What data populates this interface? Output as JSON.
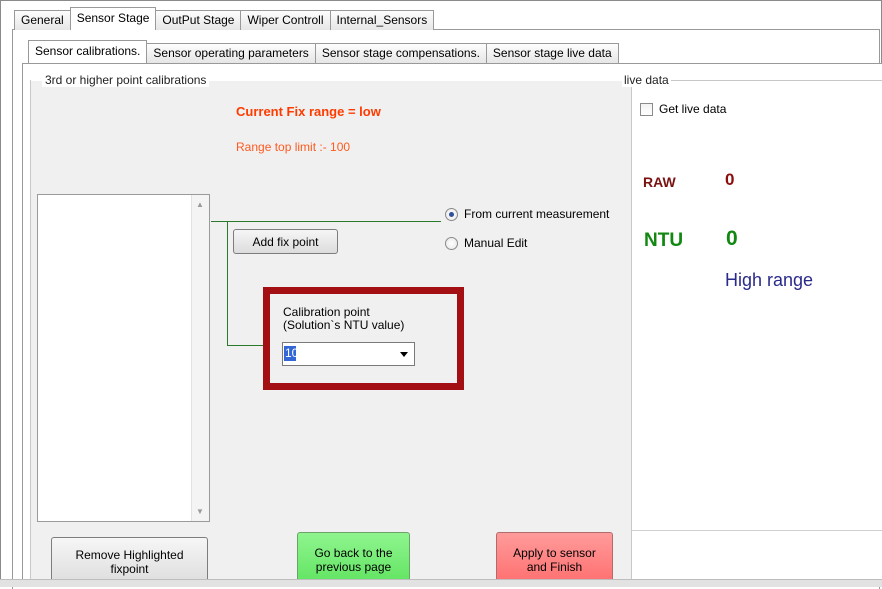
{
  "top_tabs": [
    "General",
    "Sensor Stage",
    "OutPut Stage",
    "Wiper Controll",
    "Internal_Sensors"
  ],
  "top_tab_active": "Sensor Stage",
  "sub_tabs": [
    "Sensor calibrations.",
    "Sensor operating parameters",
    "Sensor stage compensations.",
    "Sensor stage live data"
  ],
  "sub_tab_active": "Sensor calibrations.",
  "calibration": {
    "group_title": "3rd or higher point calibrations",
    "fix_range_text": "Current  Fix range = low",
    "range_limit_text": "Range top limit :-   100",
    "add_fix_point_label": "Add fix point",
    "radio_current_label": "From current measurement",
    "radio_manual_label": "Manual Edit",
    "radio_selected": "From current measurement",
    "calib_point_label_line1": "Calibration point",
    "calib_point_label_line2": "(Solution`s NTU value)",
    "calib_point_value": "10",
    "remove_button_label_line1": "Remove Highlighted",
    "remove_button_label_line2": "fixpoint",
    "back_button_label_line1": "Go back to the",
    "back_button_label_line2": "previous page",
    "apply_button_label_line1": "Apply to sensor",
    "apply_button_label_line2": "and Finish"
  },
  "live": {
    "group_title": "live data",
    "get_live_data_label": "Get live data",
    "raw_label": "RAW",
    "raw_value": "0",
    "ntu_label": "NTU",
    "ntu_value": "0",
    "range_text": "High range"
  },
  "colors": {
    "fix_range": "#ff3b00",
    "highlight_border": "#a30f12",
    "raw": "#8b0e0e",
    "ntu": "#118811",
    "high_range": "#2a2a8a",
    "back_button": "#6fe96f",
    "apply_button": "#ff7a7a"
  }
}
